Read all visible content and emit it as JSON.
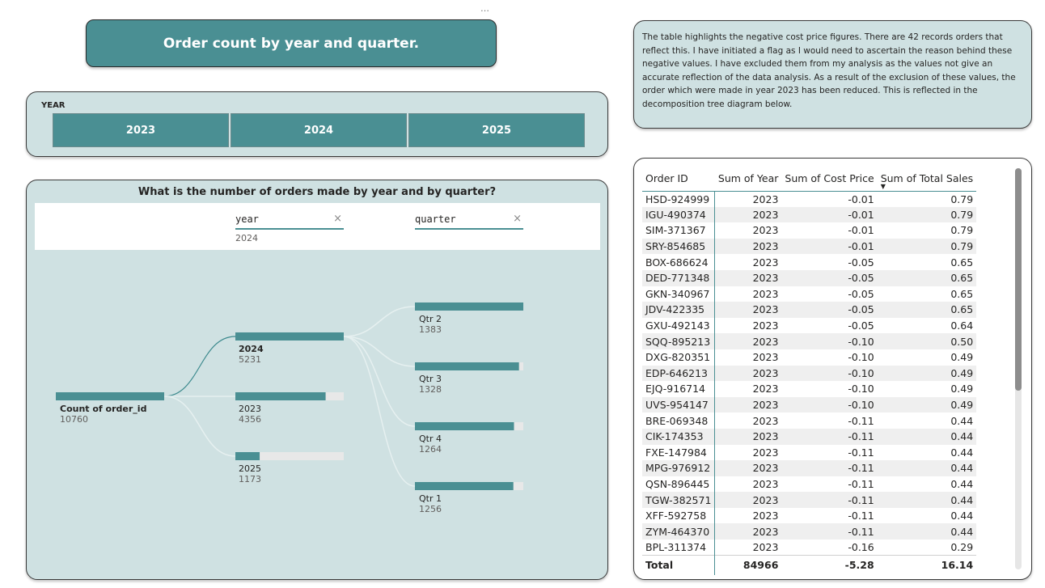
{
  "header": {
    "more_icon": "…",
    "title": "Order count by year and quarter."
  },
  "slicer": {
    "label": "YEAR",
    "options": [
      "2023",
      "2024",
      "2025"
    ]
  },
  "tree": {
    "title": "What is the number of orders made by year and by quarter?",
    "levels": [
      {
        "name": "year",
        "selected": "2024",
        "close_icon": "×"
      },
      {
        "name": "quarter",
        "selected": "",
        "close_icon": "×"
      }
    ],
    "root": {
      "label": "Count of order_id",
      "value": "10760"
    },
    "years": [
      {
        "label": "2024",
        "value": "5231",
        "share": 1.0,
        "selected": true
      },
      {
        "label": "2023",
        "value": "4356",
        "share": 0.8327,
        "selected": false
      },
      {
        "label": "2025",
        "value": "1173",
        "share": 0.2242,
        "selected": false
      }
    ],
    "quarters": [
      {
        "label": "Qtr 2",
        "value": "1383",
        "share": 1.0
      },
      {
        "label": "Qtr 3",
        "value": "1328",
        "share": 0.9602
      },
      {
        "label": "Qtr 4",
        "value": "1264",
        "share": 0.914
      },
      {
        "label": "Qtr 1",
        "value": "1256",
        "share": 0.9082
      }
    ],
    "colors": {
      "bar": "#4a8f93",
      "track": "#e8e8e8",
      "link_active": "#3d8a8e",
      "link_muted": "#e6f0f0"
    }
  },
  "note": {
    "text": "The table highlights the negative cost price figures. There are 42 records orders that reflect this. I have initiated a flag as I would need to ascertain the reason behind these negative values. I have excluded them from my analysis as the values not give an accurate reflection of the data analysis. As a result of the exclusion of these values, the order which were made in year 2023 has been reduced. This is reflected in the decomposition tree diagram below."
  },
  "table": {
    "columns": [
      "Order ID",
      "Sum of Year",
      "Sum of Cost Price",
      "Sum of Total Sales"
    ],
    "sort_icon": "▼",
    "rows": [
      [
        "HSD-924999",
        "2023",
        "-0.01",
        "0.79"
      ],
      [
        "IGU-490374",
        "2023",
        "-0.01",
        "0.79"
      ],
      [
        "SIM-371367",
        "2023",
        "-0.01",
        "0.79"
      ],
      [
        "SRY-854685",
        "2023",
        "-0.01",
        "0.79"
      ],
      [
        "BOX-686624",
        "2023",
        "-0.05",
        "0.65"
      ],
      [
        "DED-771348",
        "2023",
        "-0.05",
        "0.65"
      ],
      [
        "GKN-340967",
        "2023",
        "-0.05",
        "0.65"
      ],
      [
        "JDV-422335",
        "2023",
        "-0.05",
        "0.65"
      ],
      [
        "GXU-492143",
        "2023",
        "-0.05",
        "0.64"
      ],
      [
        "SQQ-895213",
        "2023",
        "-0.10",
        "0.50"
      ],
      [
        "DXG-820351",
        "2023",
        "-0.10",
        "0.49"
      ],
      [
        "EDP-646213",
        "2023",
        "-0.10",
        "0.49"
      ],
      [
        "EJQ-916714",
        "2023",
        "-0.10",
        "0.49"
      ],
      [
        "UVS-954147",
        "2023",
        "-0.10",
        "0.49"
      ],
      [
        "BRE-069348",
        "2023",
        "-0.11",
        "0.44"
      ],
      [
        "CIK-174353",
        "2023",
        "-0.11",
        "0.44"
      ],
      [
        "FXE-147984",
        "2023",
        "-0.11",
        "0.44"
      ],
      [
        "MPG-976912",
        "2023",
        "-0.11",
        "0.44"
      ],
      [
        "QSN-896445",
        "2023",
        "-0.11",
        "0.44"
      ],
      [
        "TGW-382571",
        "2023",
        "-0.11",
        "0.44"
      ],
      [
        "XFF-592758",
        "2023",
        "-0.11",
        "0.44"
      ],
      [
        "ZYM-464370",
        "2023",
        "-0.11",
        "0.44"
      ],
      [
        "BPL-311374",
        "2023",
        "-0.16",
        "0.29"
      ]
    ],
    "total": [
      "Total",
      "84966",
      "-5.28",
      "16.14"
    ]
  }
}
